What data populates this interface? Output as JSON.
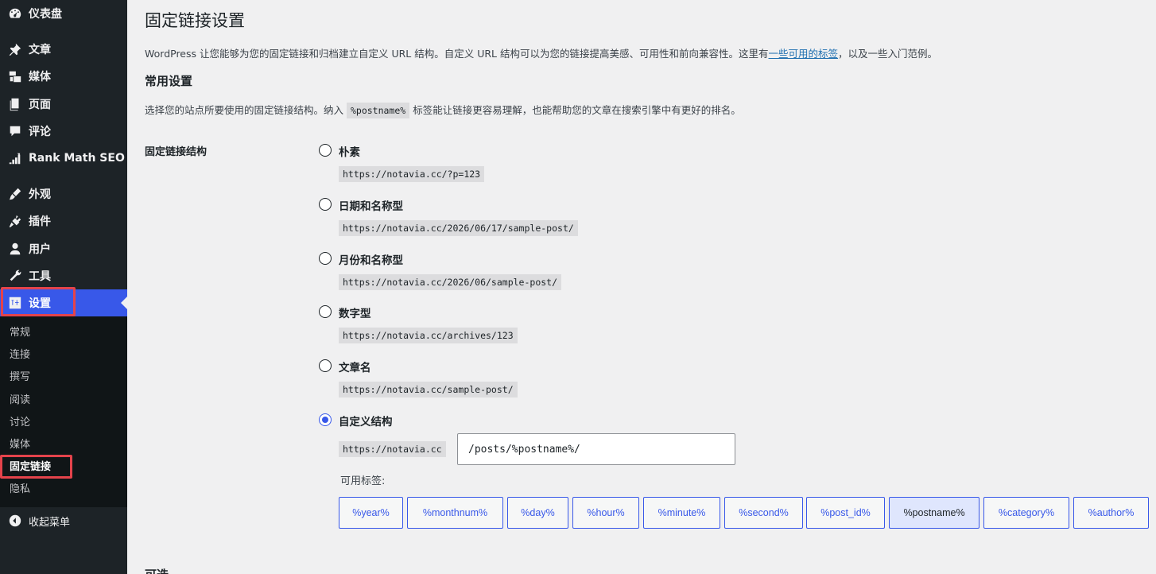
{
  "sidebar": {
    "items": [
      {
        "label": "仪表盘",
        "icon": "dashboard-icon"
      },
      {
        "label": "文章",
        "icon": "pin-icon"
      },
      {
        "label": "媒体",
        "icon": "media-icon"
      },
      {
        "label": "页面",
        "icon": "page-icon"
      },
      {
        "label": "评论",
        "icon": "comment-icon"
      },
      {
        "label": "Rank Math SEO",
        "icon": "rank-math-icon"
      },
      {
        "label": "外观",
        "icon": "brush-icon"
      },
      {
        "label": "插件",
        "icon": "plugin-icon"
      },
      {
        "label": "用户",
        "icon": "user-icon"
      },
      {
        "label": "工具",
        "icon": "wrench-icon"
      },
      {
        "label": "设置",
        "icon": "settings-icon"
      }
    ],
    "submenu": [
      "常规",
      "连接",
      "撰写",
      "阅读",
      "讨论",
      "媒体",
      "固定链接",
      "隐私"
    ],
    "collapse_label": "收起菜单"
  },
  "page": {
    "title": "固定链接设置",
    "intro_before": "WordPress 让您能够为您的固定链接和归档建立自定义 URL 结构。自定义 URL 结构可以为您的链接提高美感、可用性和前向兼容性。这里有",
    "intro_link": "一些可用的标签",
    "intro_after": "，以及一些入门范例。",
    "common_heading": "常用设置",
    "desc_before": "选择您的站点所要使用的固定链接结构。纳入 ",
    "desc_code": "%postname%",
    "desc_after": " 标签能让链接更容易理解，也能帮助您的文章在搜索引擎中有更好的排名。",
    "structure_label": "固定链接结构",
    "options": [
      {
        "label": "朴素",
        "example": "https://notavia.cc/?p=123"
      },
      {
        "label": "日期和名称型",
        "example": "https://notavia.cc/2026/06/17/sample-post/"
      },
      {
        "label": "月份和名称型",
        "example": "https://notavia.cc/2026/06/sample-post/"
      },
      {
        "label": "数字型",
        "example": "https://notavia.cc/archives/123"
      },
      {
        "label": "文章名",
        "example": "https://notavia.cc/sample-post/"
      },
      {
        "label": "自定义结构",
        "example": "https://notavia.cc"
      }
    ],
    "custom_value": "/posts/%postname%/",
    "tags_label": "可用标签:",
    "tags": [
      "%year%",
      "%monthnum%",
      "%day%",
      "%hour%",
      "%minute%",
      "%second%",
      "%post_id%",
      "%postname%",
      "%category%",
      "%author%"
    ],
    "optional_heading": "可选"
  },
  "colors": {
    "accent": "#3858e9",
    "sidebar_bg": "#1d2327",
    "highlight": "#e4434b"
  }
}
